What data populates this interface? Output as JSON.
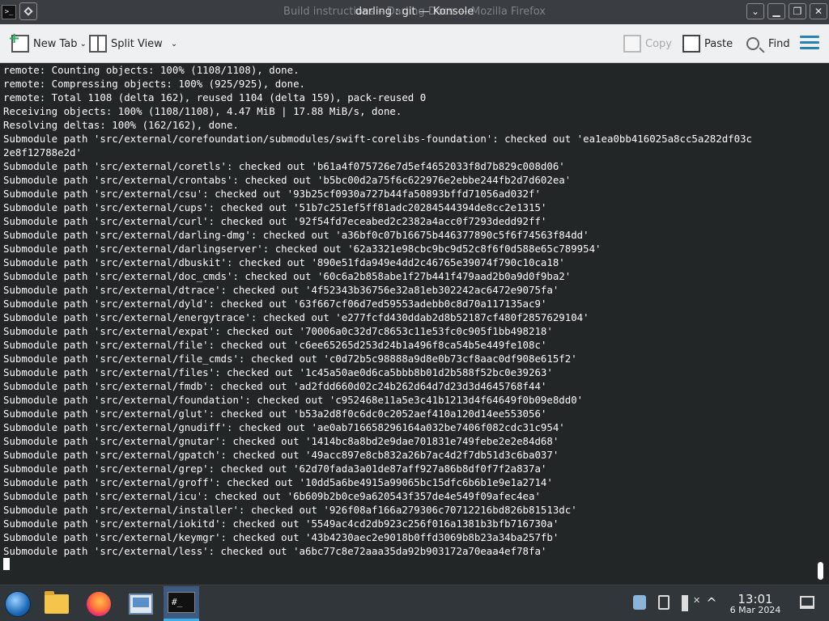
{
  "window": {
    "title_background": "Build instructions – Darling Docs — Mozilla Firefox",
    "title": "darling : git — Konsole",
    "app_icon_text": ">_",
    "buttons": {
      "collapse": "⌄",
      "minimize": "▁",
      "maximize": "❐",
      "close": "✕"
    }
  },
  "toolbar": {
    "new_tab": "New Tab",
    "split_view": "Split View",
    "copy": "Copy",
    "paste": "Paste",
    "find": "Find",
    "accent_color": "#2980b9"
  },
  "terminal": {
    "lines": [
      "remote: Counting objects: 100% (1108/1108), done.",
      "remote: Compressing objects: 100% (925/925), done.",
      "remote: Total 1108 (delta 162), reused 1104 (delta 159), pack-reused 0",
      "Receiving objects: 100% (1108/1108), 4.47 MiB | 17.88 MiB/s, done.",
      "Resolving deltas: 100% (162/162), done.",
      "Submodule path 'src/external/corefoundation/submodules/swift-corelibs-foundation': checked out 'ea1ea0bb416025a8cc5a282df03c",
      "2e8f12788e2d'",
      "Submodule path 'src/external/coretls': checked out 'b61a4f075726e7d5ef4652033f8d7b829c008d06'",
      "Submodule path 'src/external/crontabs': checked out 'b5bc00d2a75f6c622976e2ebbe244fb2d7d602ea'",
      "Submodule path 'src/external/csu': checked out '93b25cf0930a727b44fa50893bffd71056ad032f'",
      "Submodule path 'src/external/cups': checked out '51b7c251ef5ff81adc20284544394de8cc2e1315'",
      "Submodule path 'src/external/curl': checked out '92f54fd7eceabed2c2382a4acc0f7293dedd92ff'",
      "Submodule path 'src/external/darling-dmg': checked out 'a36bf0c07b16675b446377890c5f6f74563f84dd'",
      "Submodule path 'src/external/darlingserver': checked out '62a3321e98cbc9bc9d52c8f6f0d588e65c789954'",
      "Submodule path 'src/external/dbuskit': checked out '890e51fda949e4dd2c46765e39074f790c10ca18'",
      "Submodule path 'src/external/doc_cmds': checked out '60c6a2b858abe1f27b441f479aad2b0a9d0f9ba2'",
      "Submodule path 'src/external/dtrace': checked out '4f52343b36756e32a81eb302242ac6472e9075fa'",
      "Submodule path 'src/external/dyld': checked out '63f667cf06d7ed59553adebb0c8d70a117135ac9'",
      "Submodule path 'src/external/energytrace': checked out 'e277fcfd430ddab2d8b52187cf480f2857629104'",
      "Submodule path 'src/external/expat': checked out '70006a0c32d7c8653c11e53fc0c905f1bb498218'",
      "Submodule path 'src/external/file': checked out 'c6ee65265d253d24b1a496f8ca54b5e449fe108c'",
      "Submodule path 'src/external/file_cmds': checked out 'c0d72b5c98888a9d8e0b73cf8aac0df908e615f2'",
      "Submodule path 'src/external/files': checked out '1c45a50ae0d6ca5bbb8b01d2b588f52bc0e39263'",
      "Submodule path 'src/external/fmdb': checked out 'ad2fdd660d02c24b262d64d7d23d3d4645768f44'",
      "Submodule path 'src/external/foundation': checked out 'c952468e11a5e3c41b1213d4f64649f0b09e8dd0'",
      "Submodule path 'src/external/glut': checked out 'b53a2d8f0c6dc0c2052aef410a120d14ee553056'",
      "Submodule path 'src/external/gnudiff': checked out 'ae0ab716658296164a032be7406f082cdc31c954'",
      "Submodule path 'src/external/gnutar': checked out '1414bc8a8bd2e9dae701831e749febe2e2e84d68'",
      "Submodule path 'src/external/gpatch': checked out '49acc897e8cb832a26b7ac4d2f7db51d3c6ba037'",
      "Submodule path 'src/external/grep': checked out '62d70fada3a01de87aff927a86b8df0f7f2a837a'",
      "Submodule path 'src/external/groff': checked out '10dd5a6be4915a99065bc15dfc6b6b1e9e1a2714'",
      "Submodule path 'src/external/icu': checked out '6b609b2b0ce9a620543f357de4e549f09afec4ea'",
      "Submodule path 'src/external/installer': checked out '926f08af166a279306c70712216bd826b81513dc'",
      "Submodule path 'src/external/iokitd': checked out '5549ac4cd2db923c256f016a1381b3bfb716730a'",
      "Submodule path 'src/external/keymgr': checked out '43b4230aec2e9018b0ffd3069b8b23a34ba257fb'",
      "Submodule path 'src/external/less': checked out 'a6bc77c8e72aaa35da92b903172a70eaa4ef78fa'"
    ]
  },
  "taskbar": {
    "konsole_icon_text": "#_",
    "tray_arrow": "^",
    "clock_time": "13:01",
    "clock_date": "6 Mar 2024"
  }
}
